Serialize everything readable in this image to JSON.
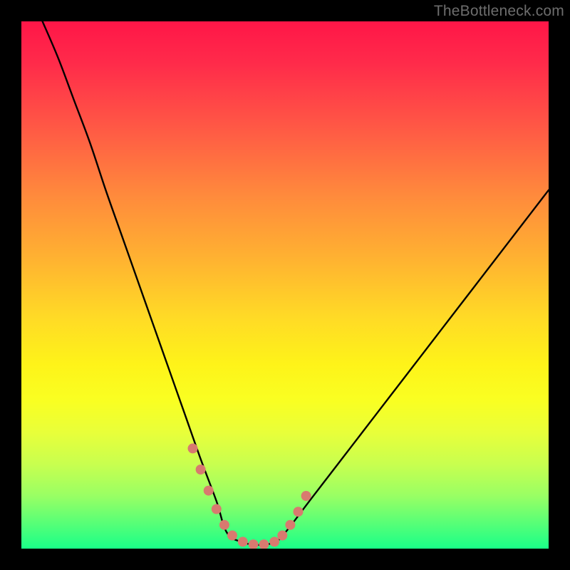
{
  "watermark": "TheBottleneck.com",
  "colors": {
    "background": "#000000",
    "curve_stroke": "#000000",
    "marker_fill": "#d87a6f",
    "gradient_stops": [
      {
        "pos": 0.0,
        "hex": "#ff1648"
      },
      {
        "pos": 0.08,
        "hex": "#ff2b4a"
      },
      {
        "pos": 0.2,
        "hex": "#ff5845"
      },
      {
        "pos": 0.33,
        "hex": "#ff8a3c"
      },
      {
        "pos": 0.45,
        "hex": "#ffb231"
      },
      {
        "pos": 0.56,
        "hex": "#ffda26"
      },
      {
        "pos": 0.65,
        "hex": "#fef319"
      },
      {
        "pos": 0.72,
        "hex": "#f9ff22"
      },
      {
        "pos": 0.78,
        "hex": "#e8ff3a"
      },
      {
        "pos": 0.84,
        "hex": "#c8ff4f"
      },
      {
        "pos": 0.9,
        "hex": "#99ff64"
      },
      {
        "pos": 0.96,
        "hex": "#4dff7a"
      },
      {
        "pos": 1.0,
        "hex": "#1aff88"
      }
    ]
  },
  "chart_data": {
    "type": "line",
    "title": "",
    "xlabel": "",
    "ylabel": "",
    "xlim": [
      0,
      100
    ],
    "ylim": [
      0,
      100
    ],
    "grid": false,
    "legend": false,
    "description": "V-shaped bottleneck curve over vertical red-to-green heat gradient. Y encodes bottleneck severity (high = red/top, low = green/bottom). Minimum (optimal match) near x≈39–50. Values estimated from pixel positions against a 0–100 normalized axis in both directions.",
    "series": [
      {
        "name": "left-branch",
        "x": [
          4,
          7,
          10,
          13,
          16,
          19,
          22,
          25,
          28,
          31,
          34,
          37,
          39
        ],
        "y": [
          100,
          93,
          85,
          77,
          68,
          59.5,
          51,
          42.5,
          34,
          25.5,
          17,
          9,
          3
        ]
      },
      {
        "name": "valley-floor",
        "x": [
          39,
          42,
          45,
          48,
          50
        ],
        "y": [
          3,
          1.2,
          0.7,
          1.2,
          3
        ]
      },
      {
        "name": "right-branch",
        "x": [
          50,
          55,
          60,
          65,
          70,
          75,
          80,
          85,
          90,
          95,
          100
        ],
        "y": [
          3,
          9.5,
          16,
          22.5,
          29,
          35.5,
          42,
          48.5,
          55,
          61.5,
          68
        ]
      }
    ],
    "markers": {
      "name": "highlighted-points",
      "note": "Salmon dotted markers straddling the minimum on both branches and along the floor",
      "x": [
        32.5,
        34,
        35.5,
        37,
        38.5,
        40,
        42,
        44,
        46,
        48,
        49.5,
        51,
        52.5,
        54
      ],
      "y": [
        19,
        15,
        11,
        7.5,
        4.5,
        2.5,
        1.3,
        0.8,
        0.8,
        1.3,
        2.5,
        4.5,
        7,
        10
      ]
    }
  }
}
